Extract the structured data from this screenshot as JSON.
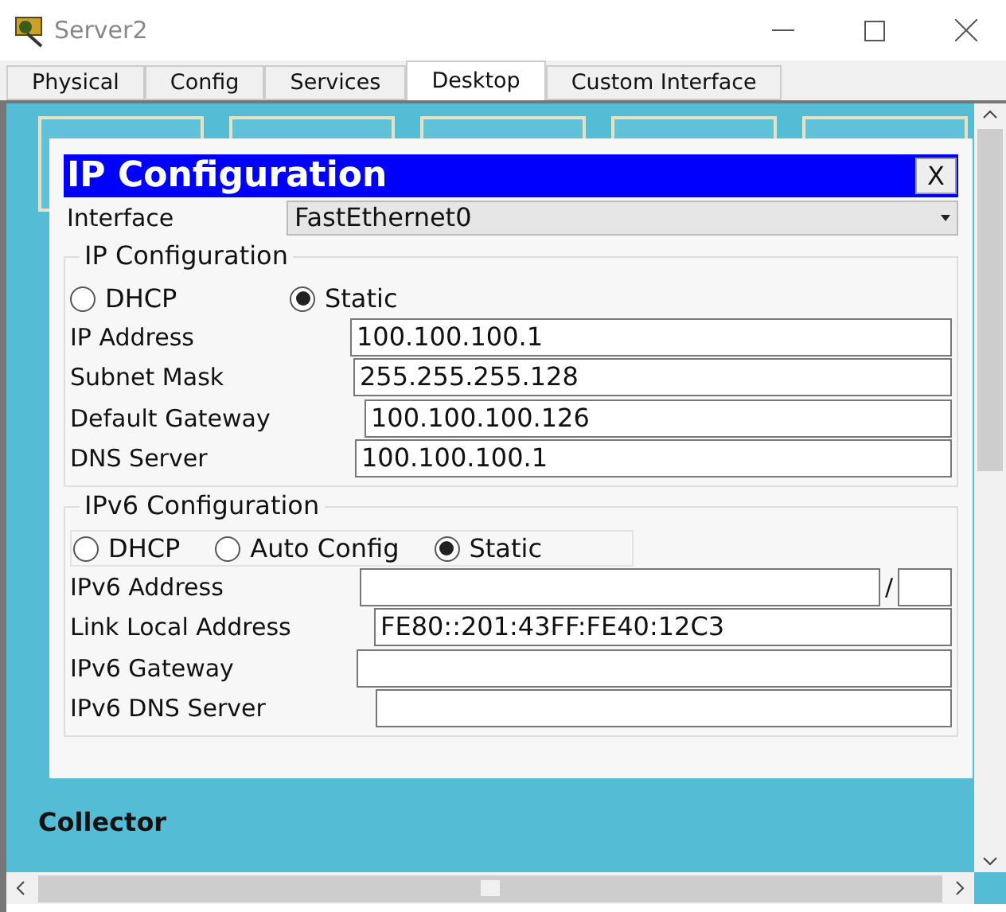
{
  "window": {
    "title": "Server2"
  },
  "tabs": [
    {
      "label": "Physical",
      "selected": false
    },
    {
      "label": "Config",
      "selected": false
    },
    {
      "label": "Services",
      "selected": false
    },
    {
      "label": "Desktop",
      "selected": true
    },
    {
      "label": "Custom Interface",
      "selected": false
    }
  ],
  "desktop": {
    "caption": "Collector"
  },
  "dialog": {
    "title": "IP Configuration",
    "close": "X",
    "interface_label": "Interface",
    "interface_value": "FastEthernet0",
    "ipv4": {
      "legend": "IP Configuration",
      "modes": [
        {
          "label": "DHCP",
          "selected": false
        },
        {
          "label": "Static",
          "selected": true
        }
      ],
      "fields": [
        {
          "label": "IP Address",
          "value": "100.100.100.1"
        },
        {
          "label": "Subnet Mask",
          "value": "255.255.255.128"
        },
        {
          "label": "Default Gateway",
          "value": "100.100.100.126"
        },
        {
          "label": "DNS Server",
          "value": "100.100.100.1"
        }
      ]
    },
    "ipv6": {
      "legend": "IPv6 Configuration",
      "modes": [
        {
          "label": "DHCP",
          "selected": false
        },
        {
          "label": "Auto Config",
          "selected": false
        },
        {
          "label": "Static",
          "selected": true
        }
      ],
      "fields": [
        {
          "label": "IPv6 Address",
          "kind": "prefix",
          "separator": "/"
        },
        {
          "label": "Link Local Address",
          "kind": "plain",
          "value": "FE80::201:43FF:FE40:12C3"
        },
        {
          "label": "IPv6 Gateway",
          "kind": "plain"
        },
        {
          "label": "IPv6 DNS Server",
          "kind": "plain"
        }
      ]
    }
  }
}
